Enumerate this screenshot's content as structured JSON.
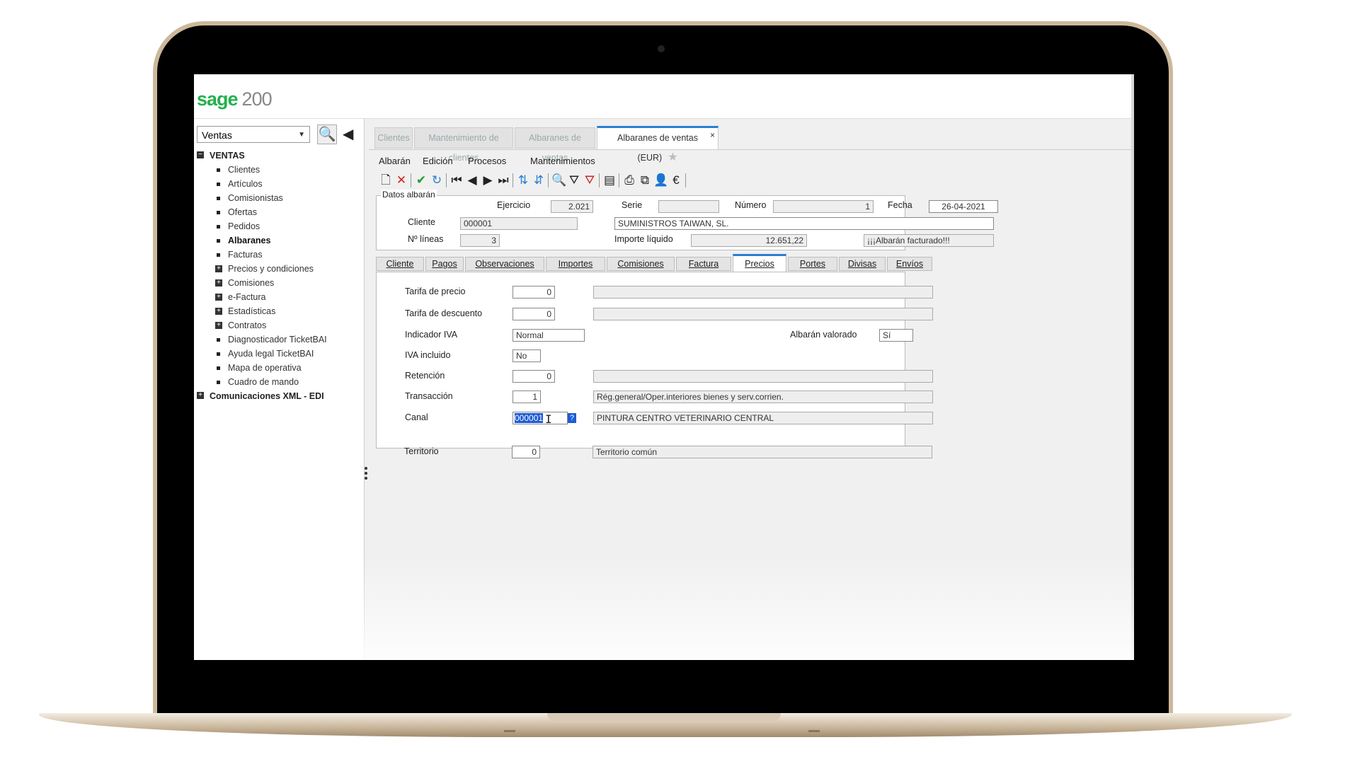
{
  "app": {
    "logo_brand": "sage",
    "logo_version": "200",
    "module": "Ventas"
  },
  "icons": {
    "search": "🔍",
    "collapse": "◀",
    "dropdown": "▼",
    "star": "★",
    "close": "×",
    "tree_minus": "−",
    "tree_plus": "+",
    "qbutton": "?",
    "ibeam": "I"
  },
  "tree": {
    "root": "VENTAS",
    "items": [
      {
        "label": "Clientes",
        "type": "bullet"
      },
      {
        "label": "Artículos",
        "type": "bullet"
      },
      {
        "label": "Comisionistas",
        "type": "bullet"
      },
      {
        "label": "Ofertas",
        "type": "bullet"
      },
      {
        "label": "Pedidos",
        "type": "bullet"
      },
      {
        "label": "Albaranes",
        "type": "bullet",
        "active": true
      },
      {
        "label": "Facturas",
        "type": "bullet"
      },
      {
        "label": "Precios y condiciones",
        "type": "plus"
      },
      {
        "label": "Comisiones",
        "type": "plus"
      },
      {
        "label": "e-Factura",
        "type": "plus"
      },
      {
        "label": "Estadísticas",
        "type": "plus"
      },
      {
        "label": "Contratos",
        "type": "plus"
      },
      {
        "label": "Diagnosticador TicketBAI",
        "type": "bullet"
      },
      {
        "label": "Ayuda legal TicketBAI",
        "type": "bullet"
      },
      {
        "label": "Mapa de operativa",
        "type": "bullet"
      },
      {
        "label": "Cuadro de mando",
        "type": "bullet"
      }
    ],
    "root2": "Comunicaciones XML - EDI"
  },
  "doc_tabs": [
    "Clientes",
    "Mantenimiento de clientes",
    "Albaranes de ventas",
    "Albaranes de ventas (EUR)"
  ],
  "menu": [
    "Albarán",
    "Edición",
    "Procesos",
    "Mantenimientos"
  ],
  "toolbar": {
    "new": "🗋",
    "delete": "✕",
    "accept": "✔",
    "undo": "↻",
    "first": "⏮",
    "prev": "◀",
    "next": "▶",
    "last": "⏭",
    "sort": "⇅",
    "sort2": "⇵",
    "find": "🔍",
    "filter": "⛛",
    "unfilter": "⛛",
    "view": "▤",
    "print": "⎙",
    "copy": "⧉",
    "user": "👤",
    "euro": "€"
  },
  "header": {
    "group_title": "Datos albarán",
    "ejercicio_label": "Ejercicio",
    "ejercicio": "2.021",
    "serie_label": "Serie",
    "serie": "",
    "numero_label": "Número",
    "numero": "1",
    "fecha_label": "Fecha",
    "fecha": "26-04-2021",
    "cliente_label": "Cliente",
    "cliente_code": "000001",
    "cliente_name": "SUMINISTROS TAIWAN, SL.",
    "lineas_label": "Nº líneas",
    "lineas": "3",
    "importe_label": "Importe líquido",
    "importe": "12.651,22",
    "estado": "¡¡¡Albarán facturado!!!"
  },
  "sub_tabs": [
    "Cliente",
    "Pagos",
    "Observaciones",
    "Importes",
    "Comisiones",
    "Factura",
    "Precios",
    "Portes",
    "Divisas",
    "Envíos"
  ],
  "precios": {
    "tarifa_precio_label": "Tarifa de precio",
    "tarifa_precio": "0",
    "tarifa_precio_desc": "",
    "tarifa_desc_label": "Tarifa de descuento",
    "tarifa_desc": "0",
    "tarifa_desc_desc": "",
    "iva_label": "Indicador IVA",
    "iva": "Normal",
    "valorado_label": "Albarán valorado",
    "valorado": "Sí",
    "iva_incl_label": "IVA incluido",
    "iva_incl": "No",
    "retencion_label": "Retención",
    "retencion": "0",
    "retencion_desc": "",
    "transaccion_label": "Transacción",
    "transaccion": "1",
    "transaccion_desc": "Rég.general/Oper.interiores bienes y serv.corrien.",
    "canal_label": "Canal",
    "canal": "000001",
    "canal_desc": "PINTURA CENTRO VETERINARIO CENTRAL",
    "territorio_label": "Territorio",
    "territorio": "0",
    "territorio_desc": "Territorio común"
  },
  "colors": {
    "brand": "#23b14d",
    "accent": "#2a7fd4",
    "selection": "#1e5bd6",
    "lid": "#cdb89c"
  }
}
